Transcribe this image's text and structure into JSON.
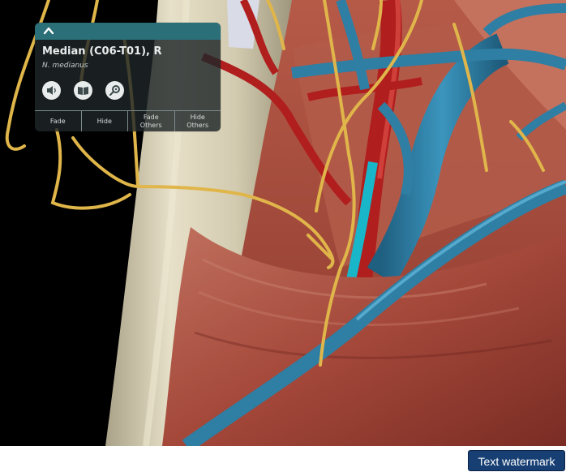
{
  "info_panel": {
    "structure_name": "Median (C06-T01), R",
    "latin_name": "N. medianus",
    "icons": [
      "chevron-up-icon",
      "speaker-icon",
      "book-icon",
      "quiz-icon"
    ],
    "actions": [
      {
        "label": "Fade"
      },
      {
        "label": "Hide"
      },
      {
        "label": "Fade\nOthers"
      },
      {
        "label": "Hide\nOthers"
      }
    ]
  },
  "watermark": "Text watermark",
  "colors": {
    "nerve": "#e0b64a",
    "artery": "#b01e1e",
    "vein": "#2f7ea3",
    "muscle": "#9c4a3c",
    "bone": "#d8d0b4",
    "panel_header": "#2b6f79"
  }
}
